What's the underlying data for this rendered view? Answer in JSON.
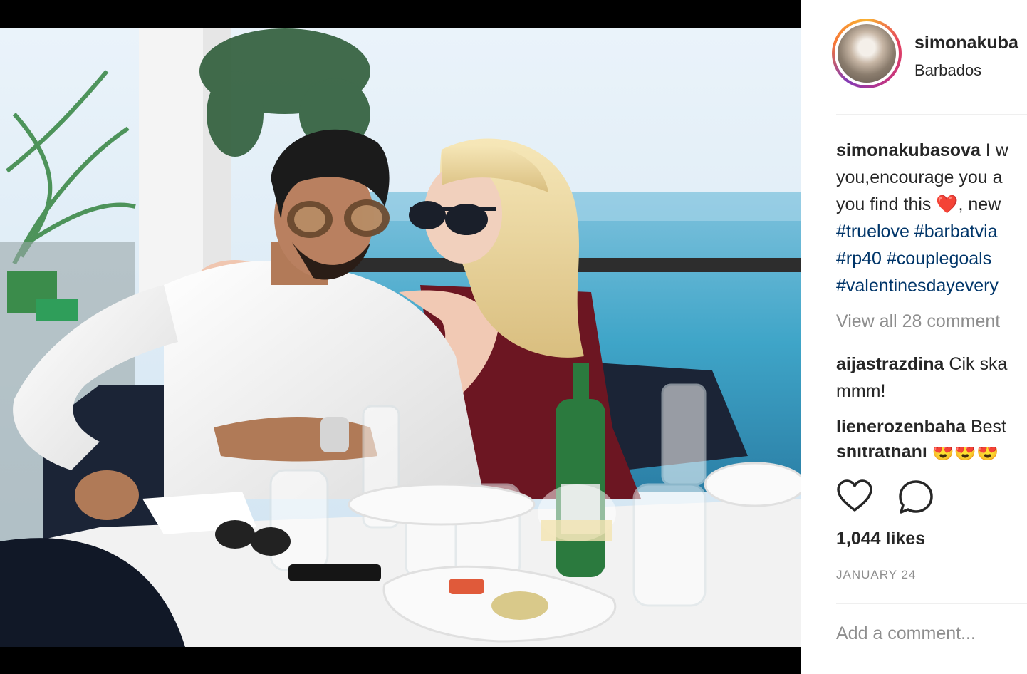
{
  "post": {
    "username": "simonakuba",
    "location": "Barbados",
    "caption": {
      "username": "simonakubasova",
      "line1": " I w",
      "line2": "you,encourage you a",
      "line3_pre": "you find this ",
      "line3_post": ", new",
      "hashtags_line1": "#truelove #barbatvia",
      "hashtags_line2": "#rp40 #couplegoals",
      "hashtags_line3": "#valentinesdayevery"
    },
    "view_all_comments": "View all 28 comment",
    "comments": [
      {
        "user": "aijastrazdina",
        "text": " Cik ska",
        "text2": "mmm!"
      },
      {
        "user": "lienerozenbaha",
        "text": " Best"
      },
      {
        "user": "shitrathani",
        "text": " 😍😍😍"
      }
    ],
    "likes": "1,044 likes",
    "date": "JANUARY 24",
    "add_comment_placeholder": "Add a comment..."
  },
  "icons": {
    "like": "heart-outline-icon",
    "comment": "speech-bubble-icon",
    "caption_heart": "red-heart-emoji"
  },
  "colors": {
    "text": "#262626",
    "muted": "#8e8e8e",
    "hashtag": "#003569",
    "heart": "#d3131a"
  }
}
